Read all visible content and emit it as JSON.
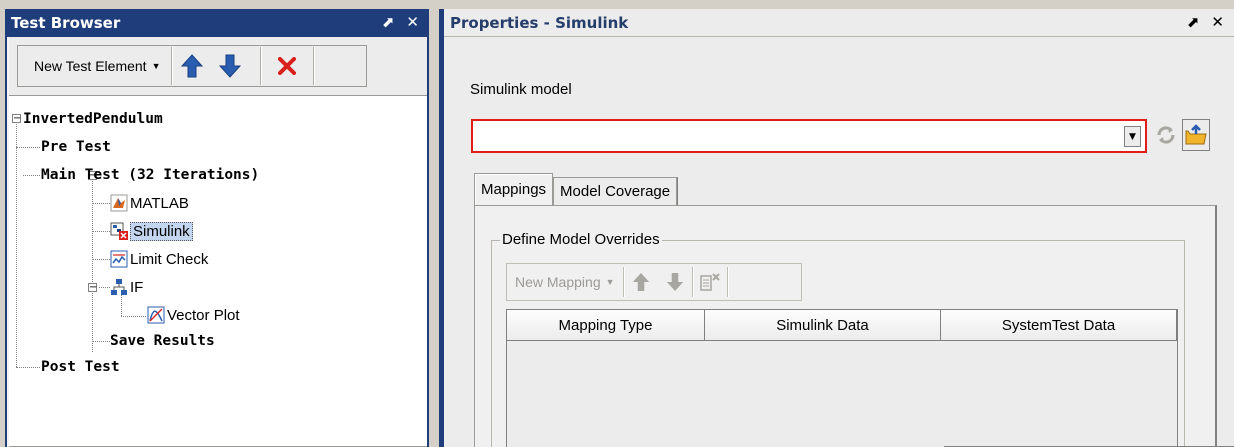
{
  "left_panel": {
    "title": "Test Browser",
    "title_buttons": {
      "pin": "⬈",
      "close": "✕"
    },
    "toolbar": {
      "new_element_label": "New Test Element",
      "move_up_icon": "arrow-up-icon",
      "move_down_icon": "arrow-down-icon",
      "delete_icon": "delete-x-icon"
    },
    "tree": {
      "root": "InvertedPendulum",
      "pre_test": "Pre Test",
      "main_test": "Main Test (32 Iterations)",
      "matlab": "MATLAB",
      "simulink": "Simulink",
      "limit_check": "Limit Check",
      "if_node": "IF",
      "vector_plot": "Vector Plot",
      "save_results": "Save Results",
      "post_test": "Post Test"
    }
  },
  "right_panel": {
    "title": "Properties - Simulink",
    "title_buttons": {
      "pin": "⬈",
      "close": "✕"
    },
    "model_label": "Simulink model",
    "model_value": "",
    "tabs": [
      {
        "label": "Mappings",
        "active": true
      },
      {
        "label": "Model Coverage",
        "active": false
      }
    ],
    "group_label": "Define Model Overrides",
    "mapping_toolbar": {
      "new_mapping_label": "New Mapping"
    },
    "table_columns": [
      "Mapping Type",
      "Simulink Data",
      "SystemTest Data"
    ]
  },
  "colors": {
    "title_bar": "#1f3d7a",
    "selection": "#c4d6ef",
    "error_border": "#e21b1b",
    "arrow_blue": "#2a5db0",
    "delete_red": "#d9201c"
  }
}
